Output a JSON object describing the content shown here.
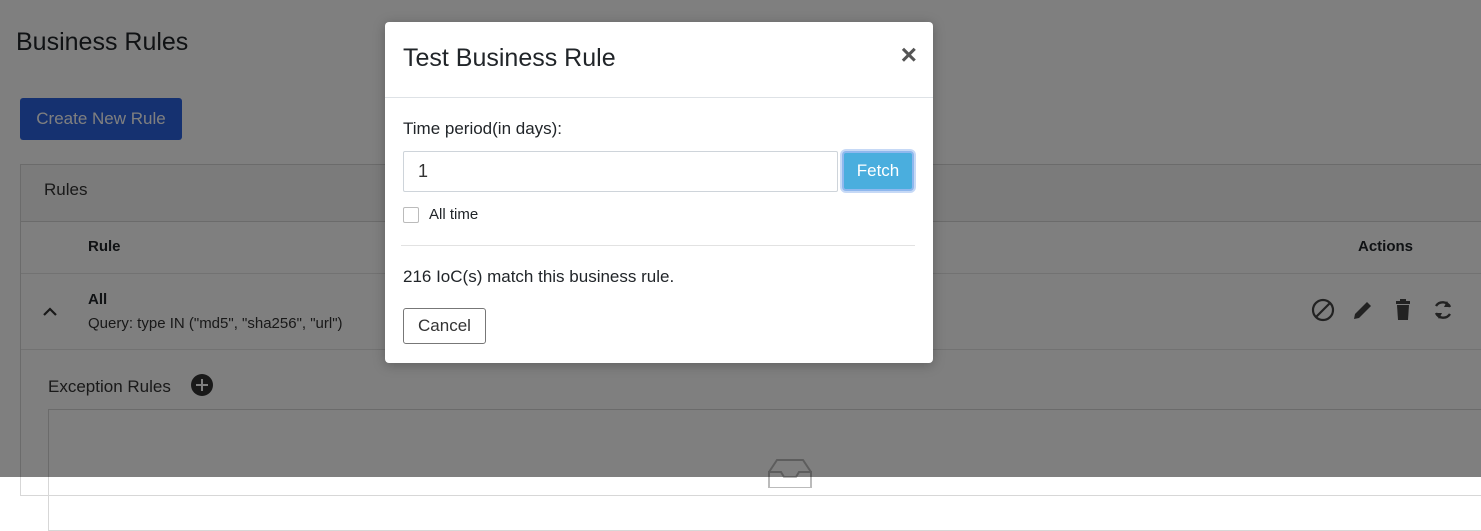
{
  "page": {
    "title": "Business Rules",
    "create_button": "Create New Rule",
    "panel_title": "Rules",
    "columns": {
      "rule": "Rule",
      "actions": "Actions"
    },
    "rule_row": {
      "name": "All",
      "query": "Query: type IN (\"md5\", \"sha256\", \"url\")",
      "action_icons": [
        "disable-icon",
        "edit-icon",
        "delete-icon",
        "sync-icon"
      ]
    },
    "exception_title": "Exception Rules"
  },
  "modal": {
    "title": "Test Business Rule",
    "close_glyph": "×",
    "time_label": "Time period(in days):",
    "time_value": "1",
    "fetch_label": "Fetch",
    "all_time_label": "All time",
    "all_time_checked": false,
    "result": "216 IoC(s) match this business rule.",
    "cancel_label": "Cancel"
  },
  "colors": {
    "primary": "#2b62e0",
    "info": "#4aaede",
    "overlay": "rgba(0,0,0,0.5)"
  }
}
